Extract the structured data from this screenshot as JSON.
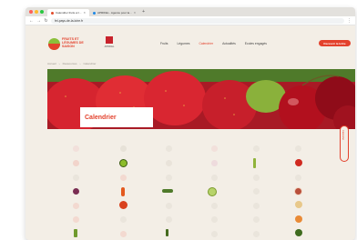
{
  "browser": {
    "tabs": [
      {
        "title": "Calendrier fruits et l..."
      },
      {
        "title": "APRIFEL - Agence pour la..."
      }
    ],
    "url": "fel-pays-de-la-loire.fr"
  },
  "site": {
    "logo_text": "FRUITS ET LÉGUMES DE SAISON",
    "partner_label": "APRIFEL",
    "nav": [
      "Fruits",
      "Légumes",
      "Calendrier",
      "Actualités",
      "Ecoles engagés"
    ],
    "cta_label": "Recevoir la lettre"
  },
  "breadcrumb": [
    "Accueil",
    "Ressources",
    "Calendrier"
  ],
  "hero": {
    "title": "Calendrier"
  },
  "side_tab": {
    "label": "Calendrier"
  },
  "colors": {
    "accent": "#e3412c",
    "background": "#f3eee6"
  }
}
